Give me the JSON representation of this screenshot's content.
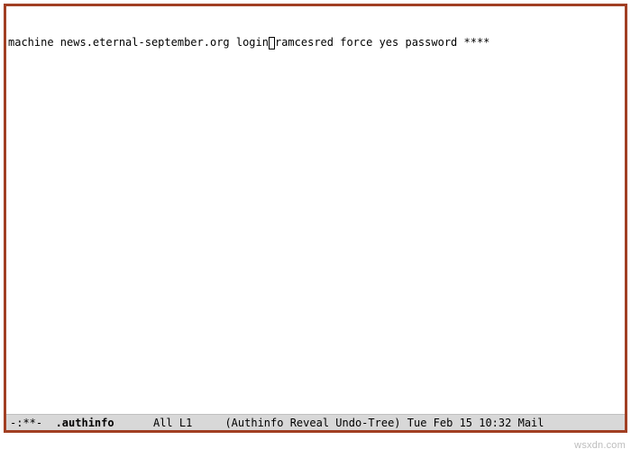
{
  "buffer": {
    "content_before_cursor": "machine news.eternal-september.org login",
    "content_after_cursor": "ramcesred force yes password ****"
  },
  "mode_line": {
    "state": "-:**-",
    "buffer_name": ".authinfo",
    "position": "All L1",
    "modes": "(Authinfo Reveal Undo-Tree)",
    "datetime": "Tue Feb 15 10:32",
    "extra": "Mail"
  },
  "echo_area": {
    "message": ""
  },
  "watermark": "wsxdn.com"
}
